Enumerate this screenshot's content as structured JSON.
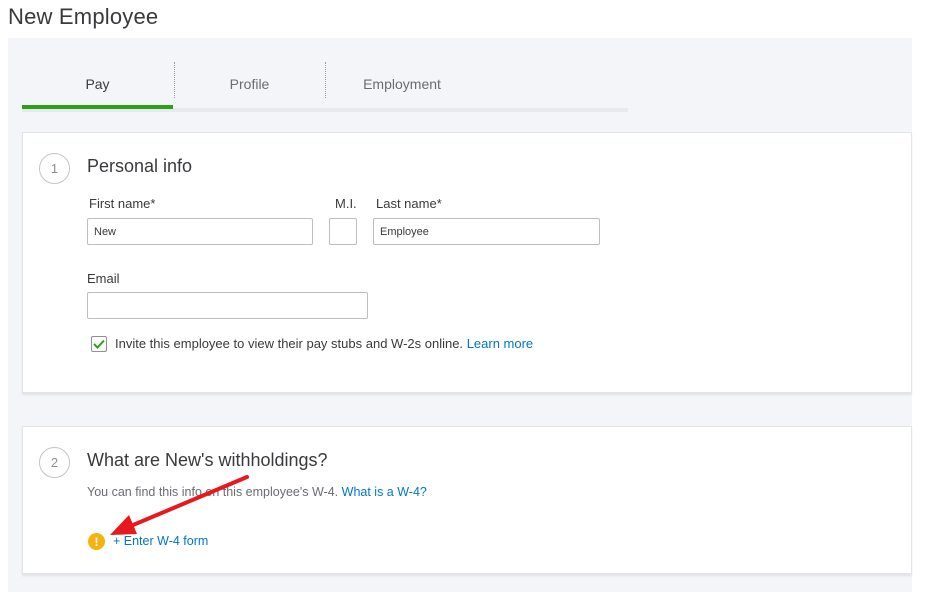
{
  "page": {
    "title": "New Employee"
  },
  "tabs": [
    {
      "label": "Pay",
      "active": true
    },
    {
      "label": "Profile",
      "active": false
    },
    {
      "label": "Employment",
      "active": false
    }
  ],
  "personal_info": {
    "step": "1",
    "title": "Personal info",
    "first_name": {
      "label": "First name*",
      "value": "New"
    },
    "middle_initial": {
      "label": "M.I.",
      "value": ""
    },
    "last_name": {
      "label": "Last name*",
      "value": "Employee"
    },
    "email": {
      "label": "Email",
      "value": ""
    },
    "invite": {
      "checked": true,
      "label": "Invite this employee to view their pay stubs and W-2s online.",
      "link": "Learn more"
    }
  },
  "withholdings": {
    "step": "2",
    "title": "What are New's withholdings?",
    "helper": "You can find this info on this employee's W-4.",
    "helper_link": "What is a W-4?",
    "enter_w4": "+ Enter W-4 form",
    "warning_icon": "exclamation-icon"
  },
  "annotation": {
    "arrow_color": "#e8191c"
  },
  "colors": {
    "accent_green": "#2ca01c",
    "link_blue": "#0077c5",
    "warning_yellow": "#f4b30f"
  }
}
